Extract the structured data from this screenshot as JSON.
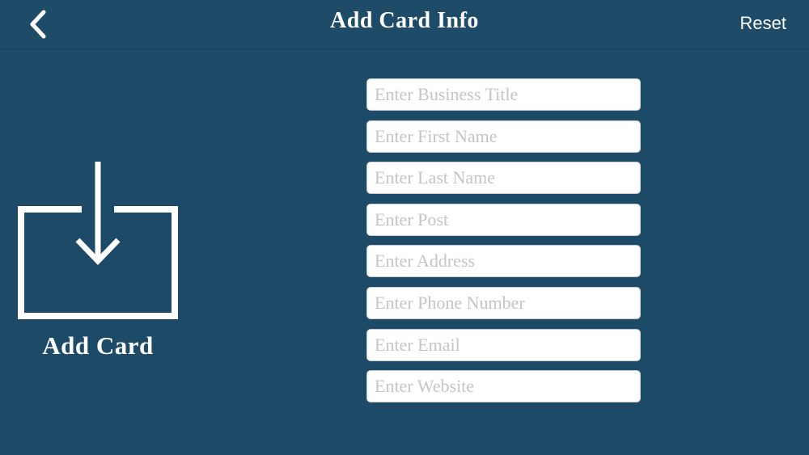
{
  "header": {
    "title": "Add Card Info",
    "reset_label": "Reset",
    "back_icon": "chevron-left-icon"
  },
  "add_card": {
    "label": "Add Card",
    "icon": "download-tray-icon"
  },
  "form": {
    "fields": [
      {
        "name": "business-title",
        "placeholder": "Enter Business Title",
        "value": ""
      },
      {
        "name": "first-name",
        "placeholder": "Enter First Name",
        "value": ""
      },
      {
        "name": "last-name",
        "placeholder": "Enter Last Name",
        "value": ""
      },
      {
        "name": "post",
        "placeholder": "Enter Post",
        "value": ""
      },
      {
        "name": "address",
        "placeholder": "Enter Address",
        "value": ""
      },
      {
        "name": "phone-number",
        "placeholder": "Enter Phone Number",
        "value": ""
      },
      {
        "name": "email",
        "placeholder": "Enter Email",
        "value": ""
      },
      {
        "name": "website",
        "placeholder": "Enter Website",
        "value": ""
      }
    ]
  },
  "colors": {
    "background": "#1d4a66",
    "text": "#ffffff",
    "placeholder": "#c5c5c7"
  }
}
